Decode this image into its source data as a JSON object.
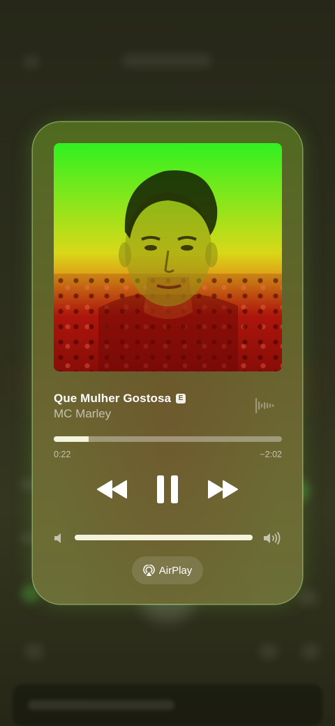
{
  "now_playing": {
    "title": "Que Mulher Gostosa",
    "explicit_badge": "E",
    "artist": "MC Marley",
    "progress": 0.154,
    "time_elapsed": "0:22",
    "time_remaining": "−2:02",
    "volume": 1.0
  },
  "controls": {
    "rewind_icon": "backward-icon",
    "pause_icon": "pause-icon",
    "forward_icon": "forward-icon",
    "volume_low_icon": "speaker-low-icon",
    "volume_high_icon": "speaker-high-icon",
    "waveform_icon": "waveform-icon"
  },
  "airplay": {
    "label": "AirPlay",
    "icon": "airplay-icon"
  },
  "colors": {
    "card_background": "#6a6430",
    "artwork_gradient_top": "#30f020",
    "artwork_gradient_bottom": "#c41c12",
    "slider_fill": "#f4f4de"
  }
}
